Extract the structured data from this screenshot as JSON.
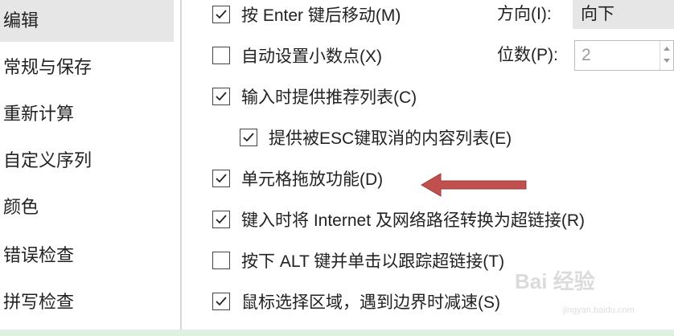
{
  "sidebar": {
    "items": [
      {
        "label": "编辑",
        "selected": true
      },
      {
        "label": "常规与保存"
      },
      {
        "label": "重新计算"
      },
      {
        "label": "自定义序列"
      },
      {
        "label": "颜色"
      },
      {
        "label": "错误检查"
      },
      {
        "label": "拼写检查"
      }
    ]
  },
  "options": [
    {
      "label": "按 Enter 键后移动(M)",
      "checked": true
    },
    {
      "label": "自动设置小数点(X)",
      "checked": false
    },
    {
      "label": "输入时提供推荐列表(C)",
      "checked": true
    },
    {
      "label": "提供被ESC键取消的内容列表(E)",
      "checked": true
    },
    {
      "label": "单元格拖放功能(D)",
      "checked": true
    },
    {
      "label": "键入时将 Internet 及网络路径转换为超链接(R)",
      "checked": true
    },
    {
      "label": "按下 ALT 键并单击以跟踪超链接(T)",
      "checked": false
    },
    {
      "label": "鼠标选择区域，遇到边界时减速(S)",
      "checked": true
    }
  ],
  "direction": {
    "label": "方向(I):",
    "value": "向下"
  },
  "places": {
    "label": "位数(P):",
    "value": "2"
  },
  "watermark": {
    "text": "Bai 经验",
    "sub": "jingyan.baidu.com"
  },
  "colors": {
    "arrow": "#c0504d",
    "selected_bg": "#e6e6e6",
    "background": "#dff0df"
  }
}
